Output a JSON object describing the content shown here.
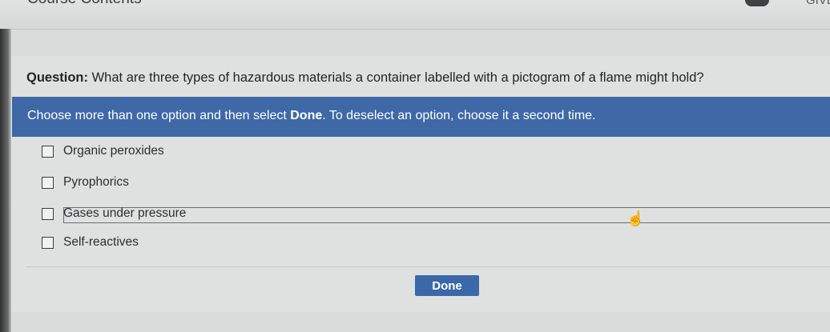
{
  "header": {
    "title": "Course Contents",
    "right_text": "GIVE"
  },
  "question": {
    "prefix": "Question:",
    "text": "What are three types of hazardous materials a container labelled with a pictogram of a flame might hold?"
  },
  "instructions": {
    "part1": "Choose more than one option and then select ",
    "bold": "Done",
    "part2": ". To deselect an option, choose it a second time."
  },
  "options": [
    {
      "label": "Organic peroxides",
      "checked": false
    },
    {
      "label": "Pyrophorics",
      "checked": false
    },
    {
      "label": "Gases under pressure",
      "checked": false
    },
    {
      "label": "Self-reactives",
      "checked": false
    }
  ],
  "done_label": "Done",
  "colors": {
    "accent": "#3f69a6",
    "button": "#3b68a8",
    "background": "#dfe1e0"
  }
}
